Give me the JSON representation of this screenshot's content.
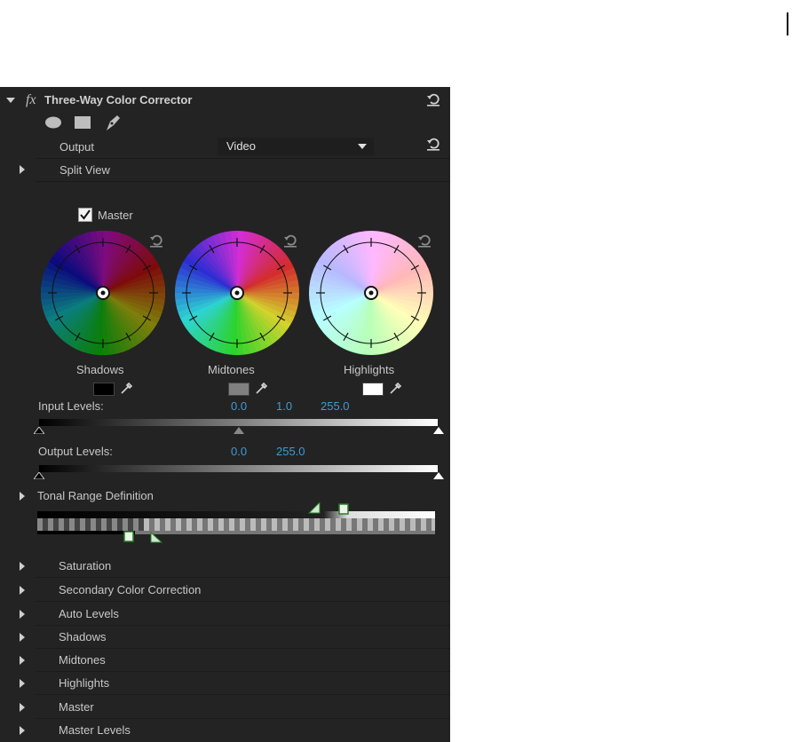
{
  "effect": {
    "fx_label": "fx",
    "title": "Three-Way Color Corrector",
    "mask_tools": [
      "ellipse-mask-icon",
      "rectangle-mask-icon",
      "pen-mask-icon"
    ]
  },
  "output": {
    "label": "Output",
    "value": "Video"
  },
  "split_view": {
    "label": "Split View"
  },
  "master": {
    "label": "Master",
    "checked": true
  },
  "wheels": [
    {
      "label": "Shadows",
      "swatch": "#000000"
    },
    {
      "label": "Midtones",
      "swatch": "#808080"
    },
    {
      "label": "Highlights",
      "swatch": "#ffffff"
    }
  ],
  "input_levels": {
    "label": "Input Levels:",
    "black": "0.0",
    "gamma": "1.0",
    "white": "255.0",
    "gamma_fraction": 0.5
  },
  "output_levels": {
    "label": "Output Levels:",
    "black": "0.0",
    "white": "255.0"
  },
  "tonal_range": {
    "label": "Tonal Range Definition"
  },
  "sections": [
    "Saturation",
    "Secondary Color Correction",
    "Auto Levels",
    "Shadows",
    "Midtones",
    "Highlights",
    "Master",
    "Master Levels"
  ],
  "colors": {
    "panel": "#232323",
    "accent_blue": "#3e9bd6",
    "text": "#c8c8c8"
  }
}
